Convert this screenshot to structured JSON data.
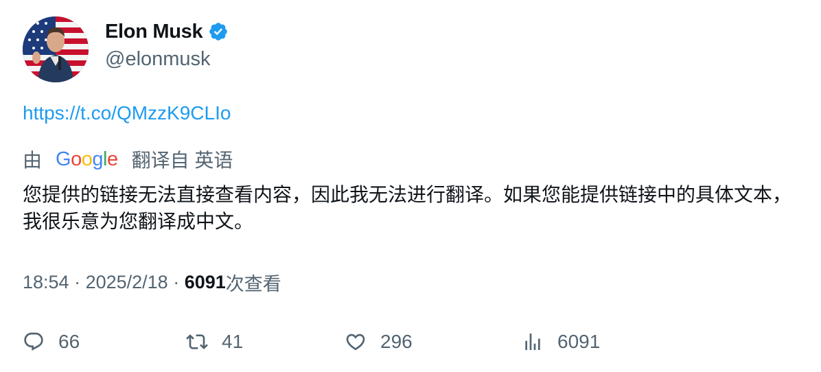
{
  "author": {
    "display_name": "Elon Musk",
    "handle": "@elonmusk",
    "verified": true,
    "avatar_icon": "avatar-photo"
  },
  "tweet": {
    "link": "https://t.co/QMzzK9CLIo",
    "translation": {
      "by_label": "由",
      "provider_letters": [
        "G",
        "o",
        "o",
        "g",
        "l",
        "e"
      ],
      "translated_from_label": "翻译自 英语",
      "text": "您提供的链接无法直接查看内容，因此我无法进行翻译。如果您能提供链接中的具体文本，我很乐意为您翻译成中文。"
    },
    "meta": {
      "time": "18:54",
      "separator": " · ",
      "date": "2025/2/18",
      "views": "6091",
      "views_label": "次查看"
    }
  },
  "actions": {
    "replies": "66",
    "retweets": "41",
    "likes": "296",
    "views": "6091"
  },
  "colors": {
    "link": "#1d9bf0",
    "secondary_text": "#536471",
    "primary_text": "#0f1419",
    "verified": "#1d9bf0"
  }
}
